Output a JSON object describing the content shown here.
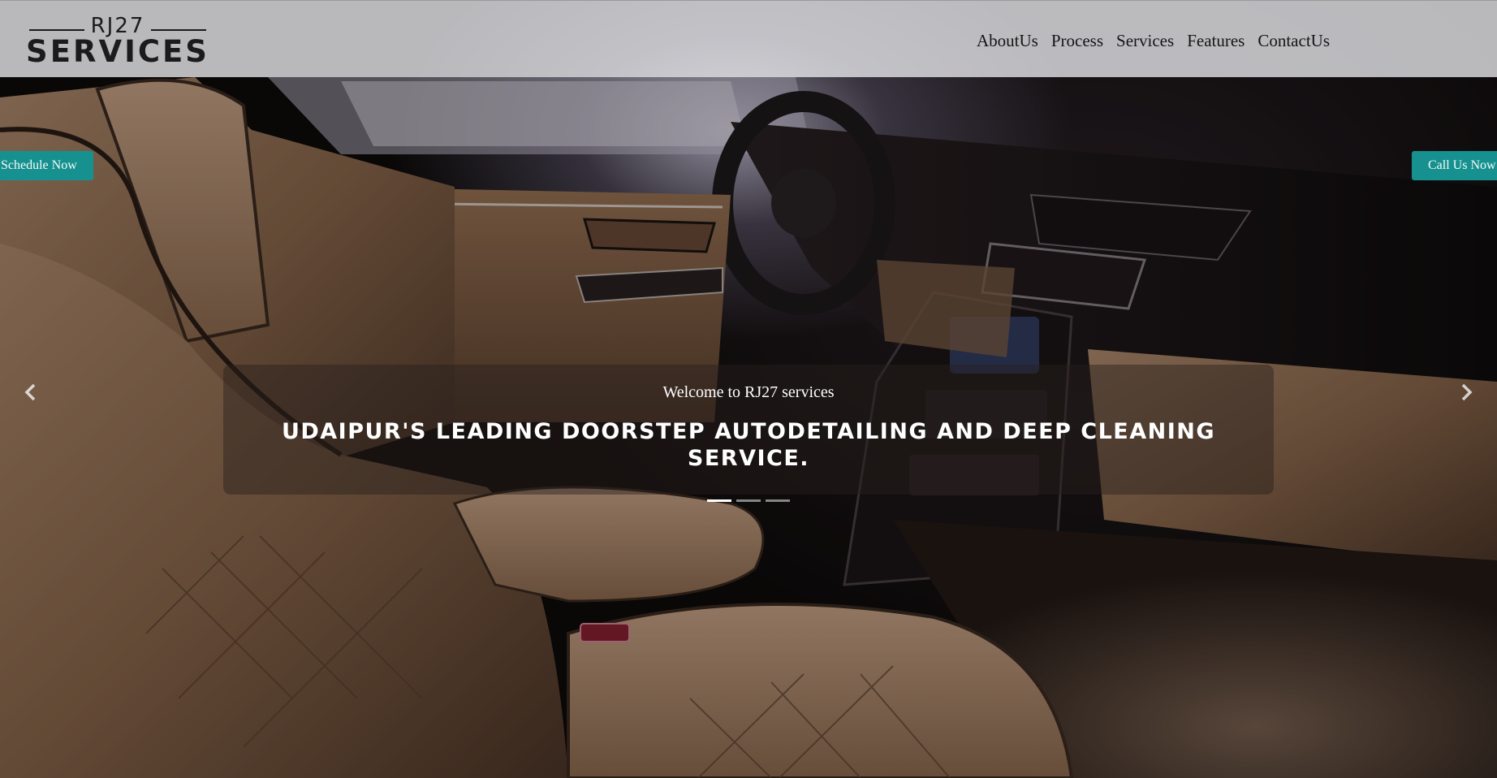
{
  "brand": {
    "logo_top": "RJ27",
    "logo_bottom": "SERVICES"
  },
  "nav": {
    "items": [
      "AboutUs",
      "Process",
      "Services",
      "Features",
      "ContactUs"
    ]
  },
  "cta": {
    "left_label": "Schedule Now",
    "right_label": "Call Us Now"
  },
  "hero": {
    "subtitle": "Welcome to RJ27 services",
    "title": "Udaipur's leading doorstep autodetailing and deep cleaning service.",
    "slide_count": 3,
    "active_slide": 1
  },
  "icons": {
    "prev": "chevron-left-icon",
    "next": "chevron-right-icon"
  },
  "colors": {
    "accent": "#17918f",
    "header_bg": "#ebebee",
    "caption_bg": "#281e1c"
  }
}
